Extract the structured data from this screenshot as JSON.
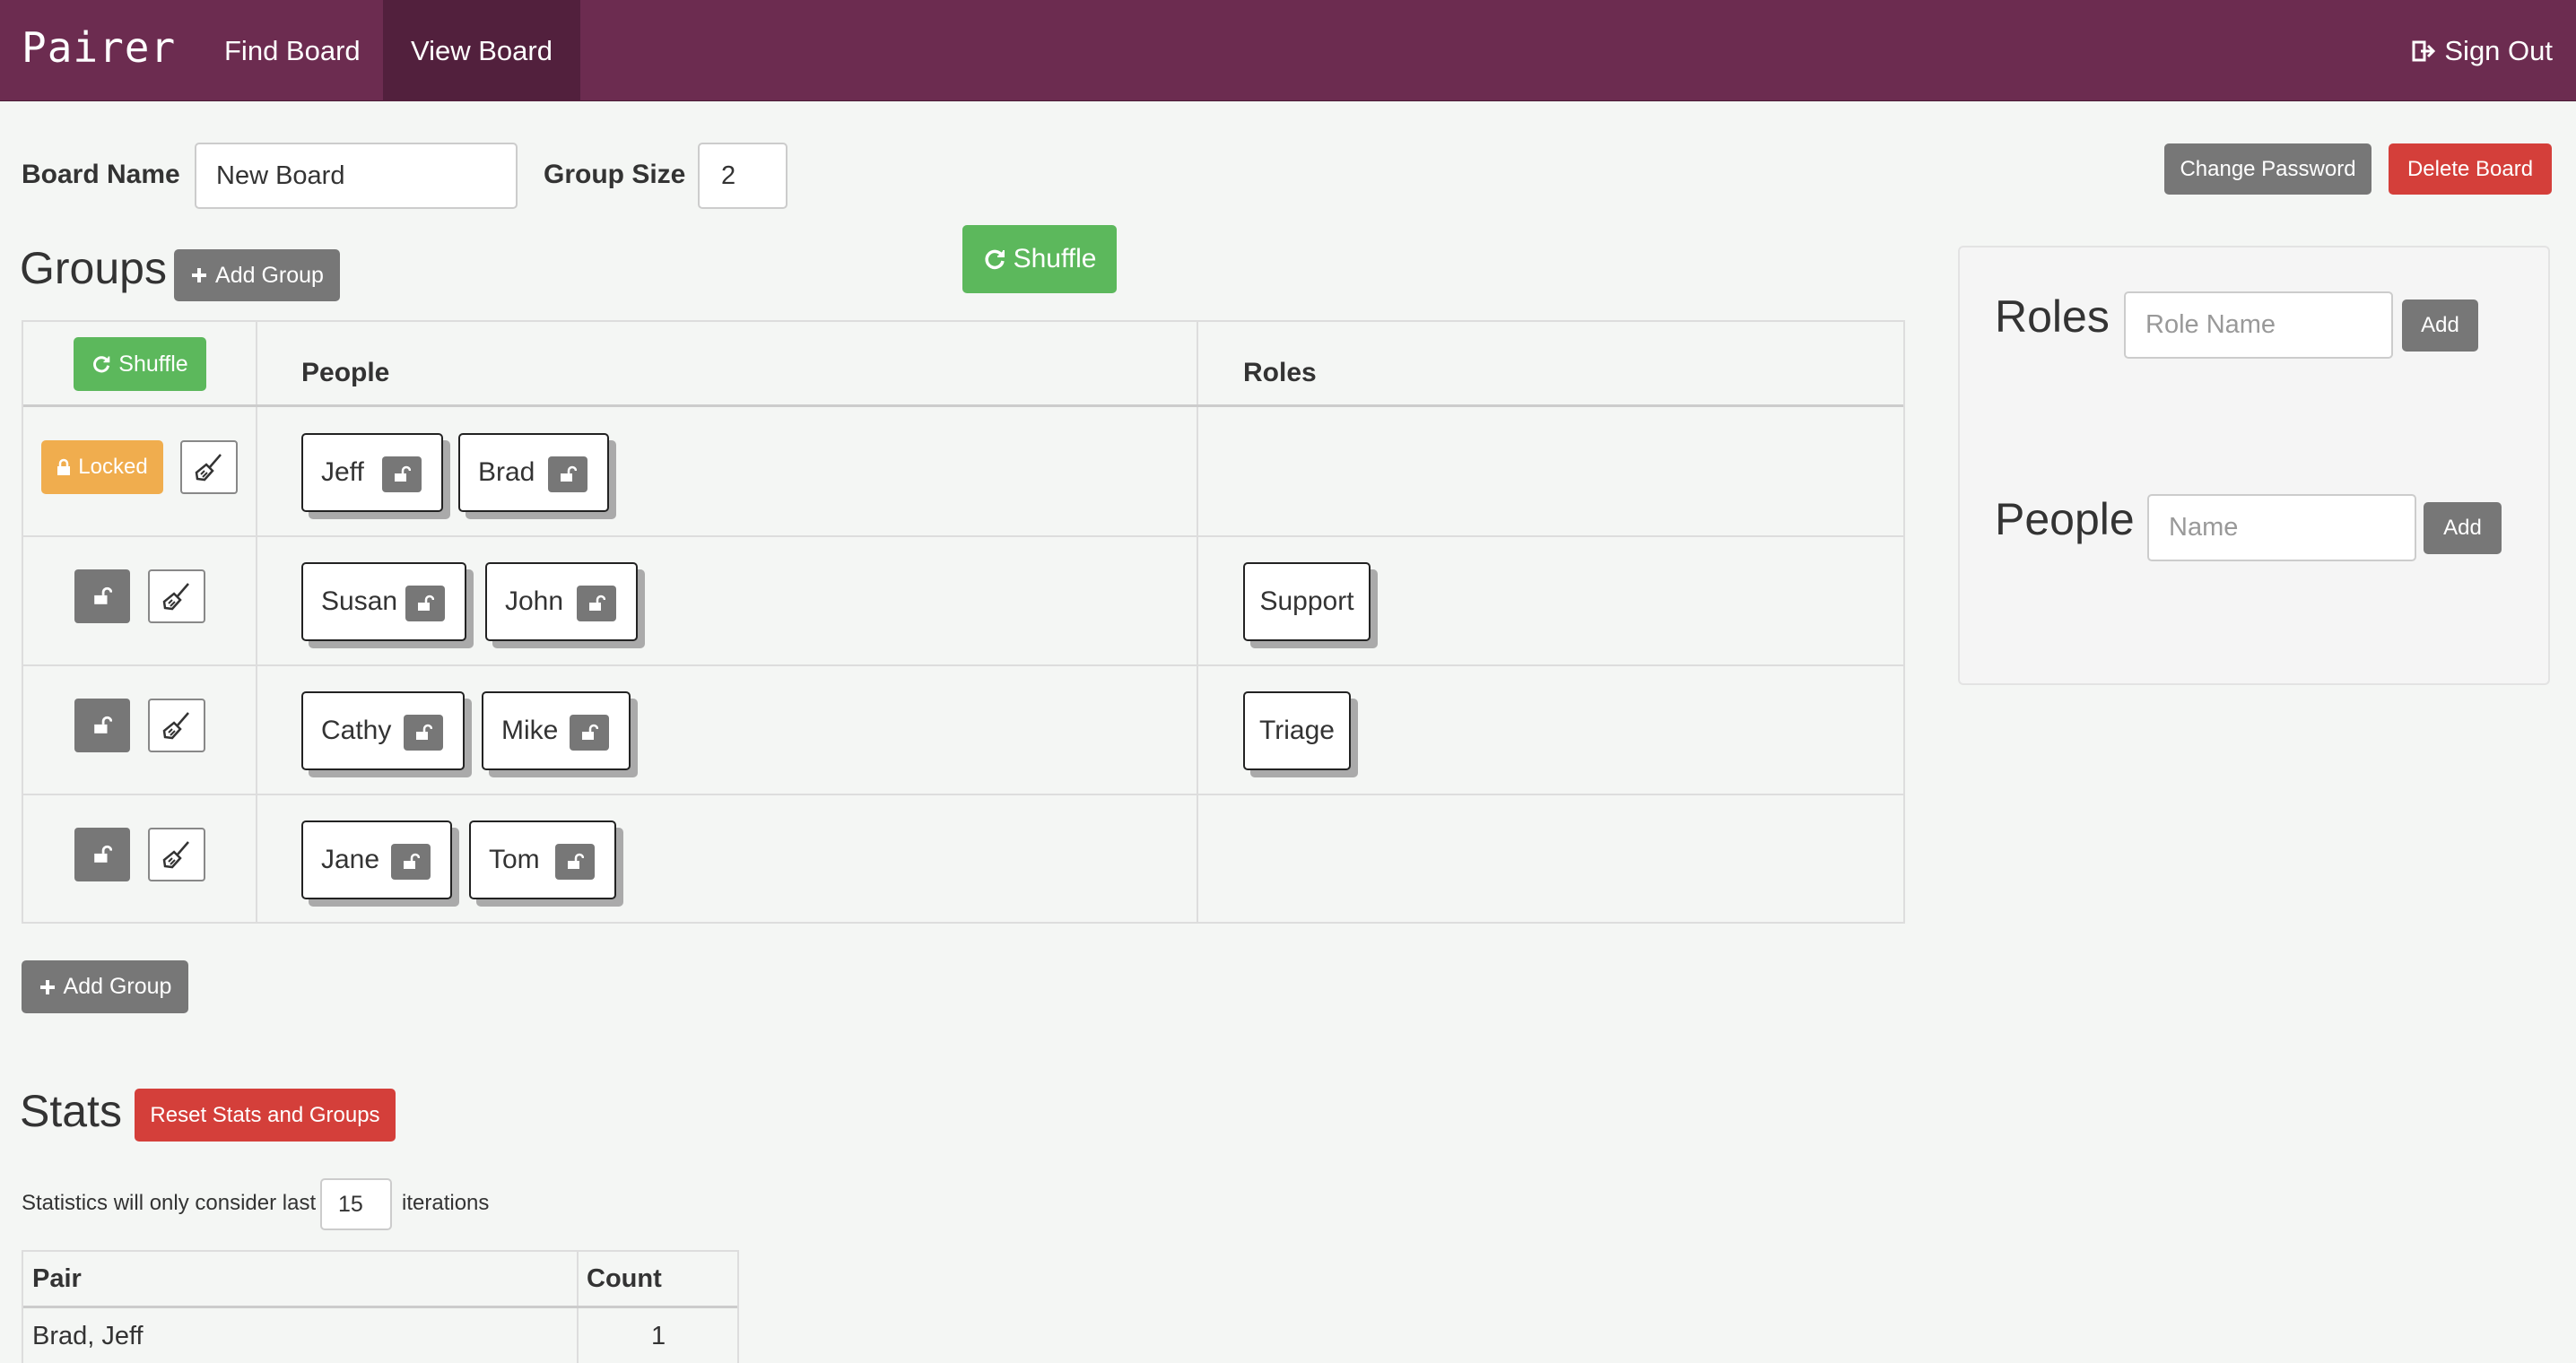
{
  "nav": {
    "brand": "Pairer",
    "find_board": "Find Board",
    "view_board": "View Board",
    "sign_out": "Sign Out"
  },
  "board": {
    "name_label": "Board Name",
    "name_value": "New Board",
    "group_size_label": "Group Size",
    "group_size_value": "2",
    "change_password": "Change Password",
    "delete_board": "Delete Board"
  },
  "groups": {
    "title": "Groups",
    "add_group": "Add Group",
    "shuffle_main": "Shuffle",
    "shuffle_table": "Shuffle",
    "col_people": "People",
    "col_roles": "Roles",
    "locked_label": "Locked",
    "rows": [
      {
        "people": [
          "Jeff",
          "Brad"
        ],
        "roles": [],
        "locked": true
      },
      {
        "people": [
          "Susan",
          "John"
        ],
        "roles": [
          "Support"
        ],
        "locked": false
      },
      {
        "people": [
          "Cathy",
          "Mike"
        ],
        "roles": [
          "Triage"
        ],
        "locked": false
      },
      {
        "people": [
          "Jane",
          "Tom"
        ],
        "roles": [],
        "locked": false
      }
    ],
    "add_group_bottom": "Add Group"
  },
  "side": {
    "roles_title": "Roles",
    "role_placeholder": "Role Name",
    "role_add": "Add",
    "people_title": "People",
    "people_placeholder": "Name",
    "people_add": "Add"
  },
  "stats": {
    "title": "Stats",
    "reset": "Reset Stats and Groups",
    "note_prefix": "Statistics will only consider last",
    "iterations_value": "15",
    "note_suffix": "iterations",
    "col_pair": "Pair",
    "col_count": "Count",
    "rows": [
      {
        "pair": "Brad, Jeff",
        "count": "1"
      }
    ]
  },
  "colors": {
    "navbar": "#6c2c50",
    "active_nav": "#52203d",
    "green": "#5cb85c",
    "red": "#d43f3a",
    "gray": "#777777",
    "orange": "#f0ad4e"
  }
}
